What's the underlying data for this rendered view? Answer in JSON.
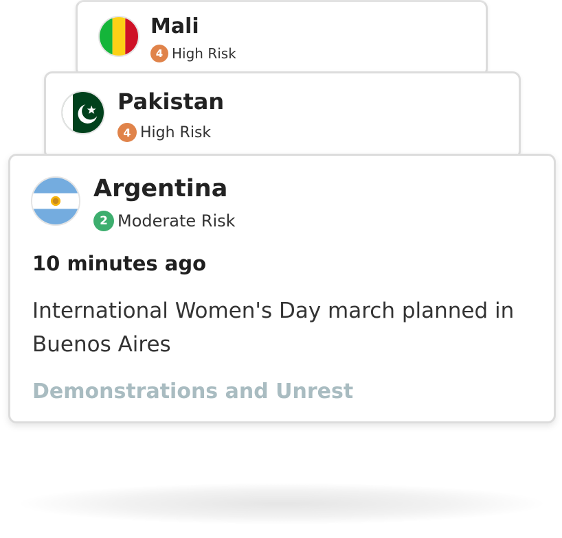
{
  "colors": {
    "high_risk": "#e0834a",
    "moderate_risk": "#3dae6e",
    "category": "#a9bcc1"
  },
  "cards": [
    {
      "country": "Mali",
      "flag_icon": "mali-flag-icon",
      "risk_level": "4",
      "risk_label": "High Risk"
    },
    {
      "country": "Pakistan",
      "flag_icon": "pakistan-flag-icon",
      "risk_level": "4",
      "risk_label": "High Risk"
    },
    {
      "country": "Argentina",
      "flag_icon": "argentina-flag-icon",
      "risk_level": "2",
      "risk_label": "Moderate Risk",
      "time": "10 minutes ago",
      "description": "International Women's Day march planned in Buenos Aires",
      "category": "Demonstrations and Unrest"
    }
  ]
}
